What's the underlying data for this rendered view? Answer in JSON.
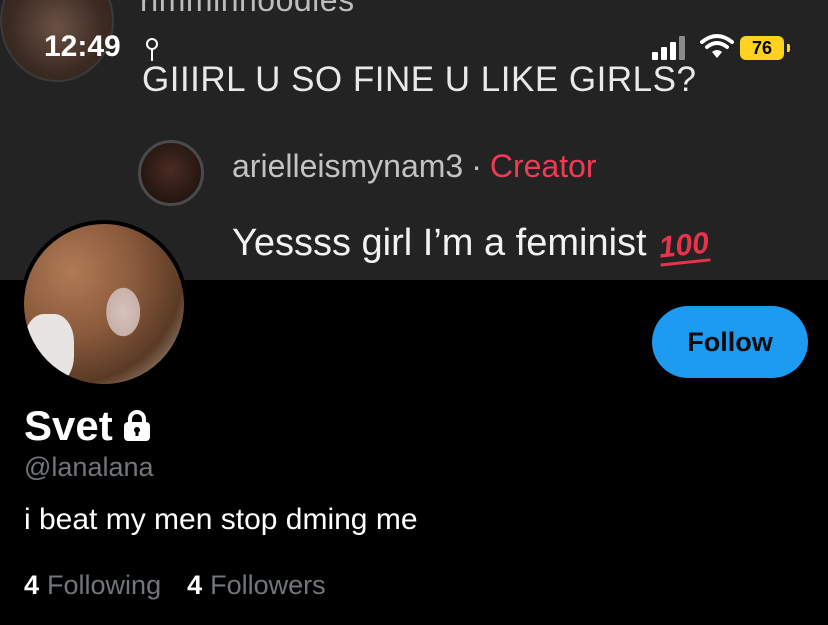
{
  "status_bar": {
    "time": "12:49",
    "battery_level": "76",
    "icons": [
      "location-icon",
      "signal-icon",
      "wifi-icon",
      "battery-icon"
    ]
  },
  "banner": {
    "cut_username": "rimminnoodles",
    "comment": "GIIIRL U SO FINE U LIKE GIRLS?",
    "reply_username": "arielleismynam3",
    "reply_separator": "·",
    "reply_badge": "Creator",
    "reply_text": "Yessss girl I’m a feminist",
    "reply_emoji": "100"
  },
  "profile": {
    "display_name": "Svet",
    "handle": "@lanalana",
    "bio": "i beat my men stop dming me",
    "following_count": "4",
    "following_label": "Following",
    "followers_count": "4",
    "followers_label": "Followers",
    "follow_button_label": "Follow"
  },
  "colors": {
    "accent": "#1d9bf0",
    "creator_badge": "#f23a57",
    "muted_text": "#71767b",
    "battery": "#ffd21f"
  }
}
